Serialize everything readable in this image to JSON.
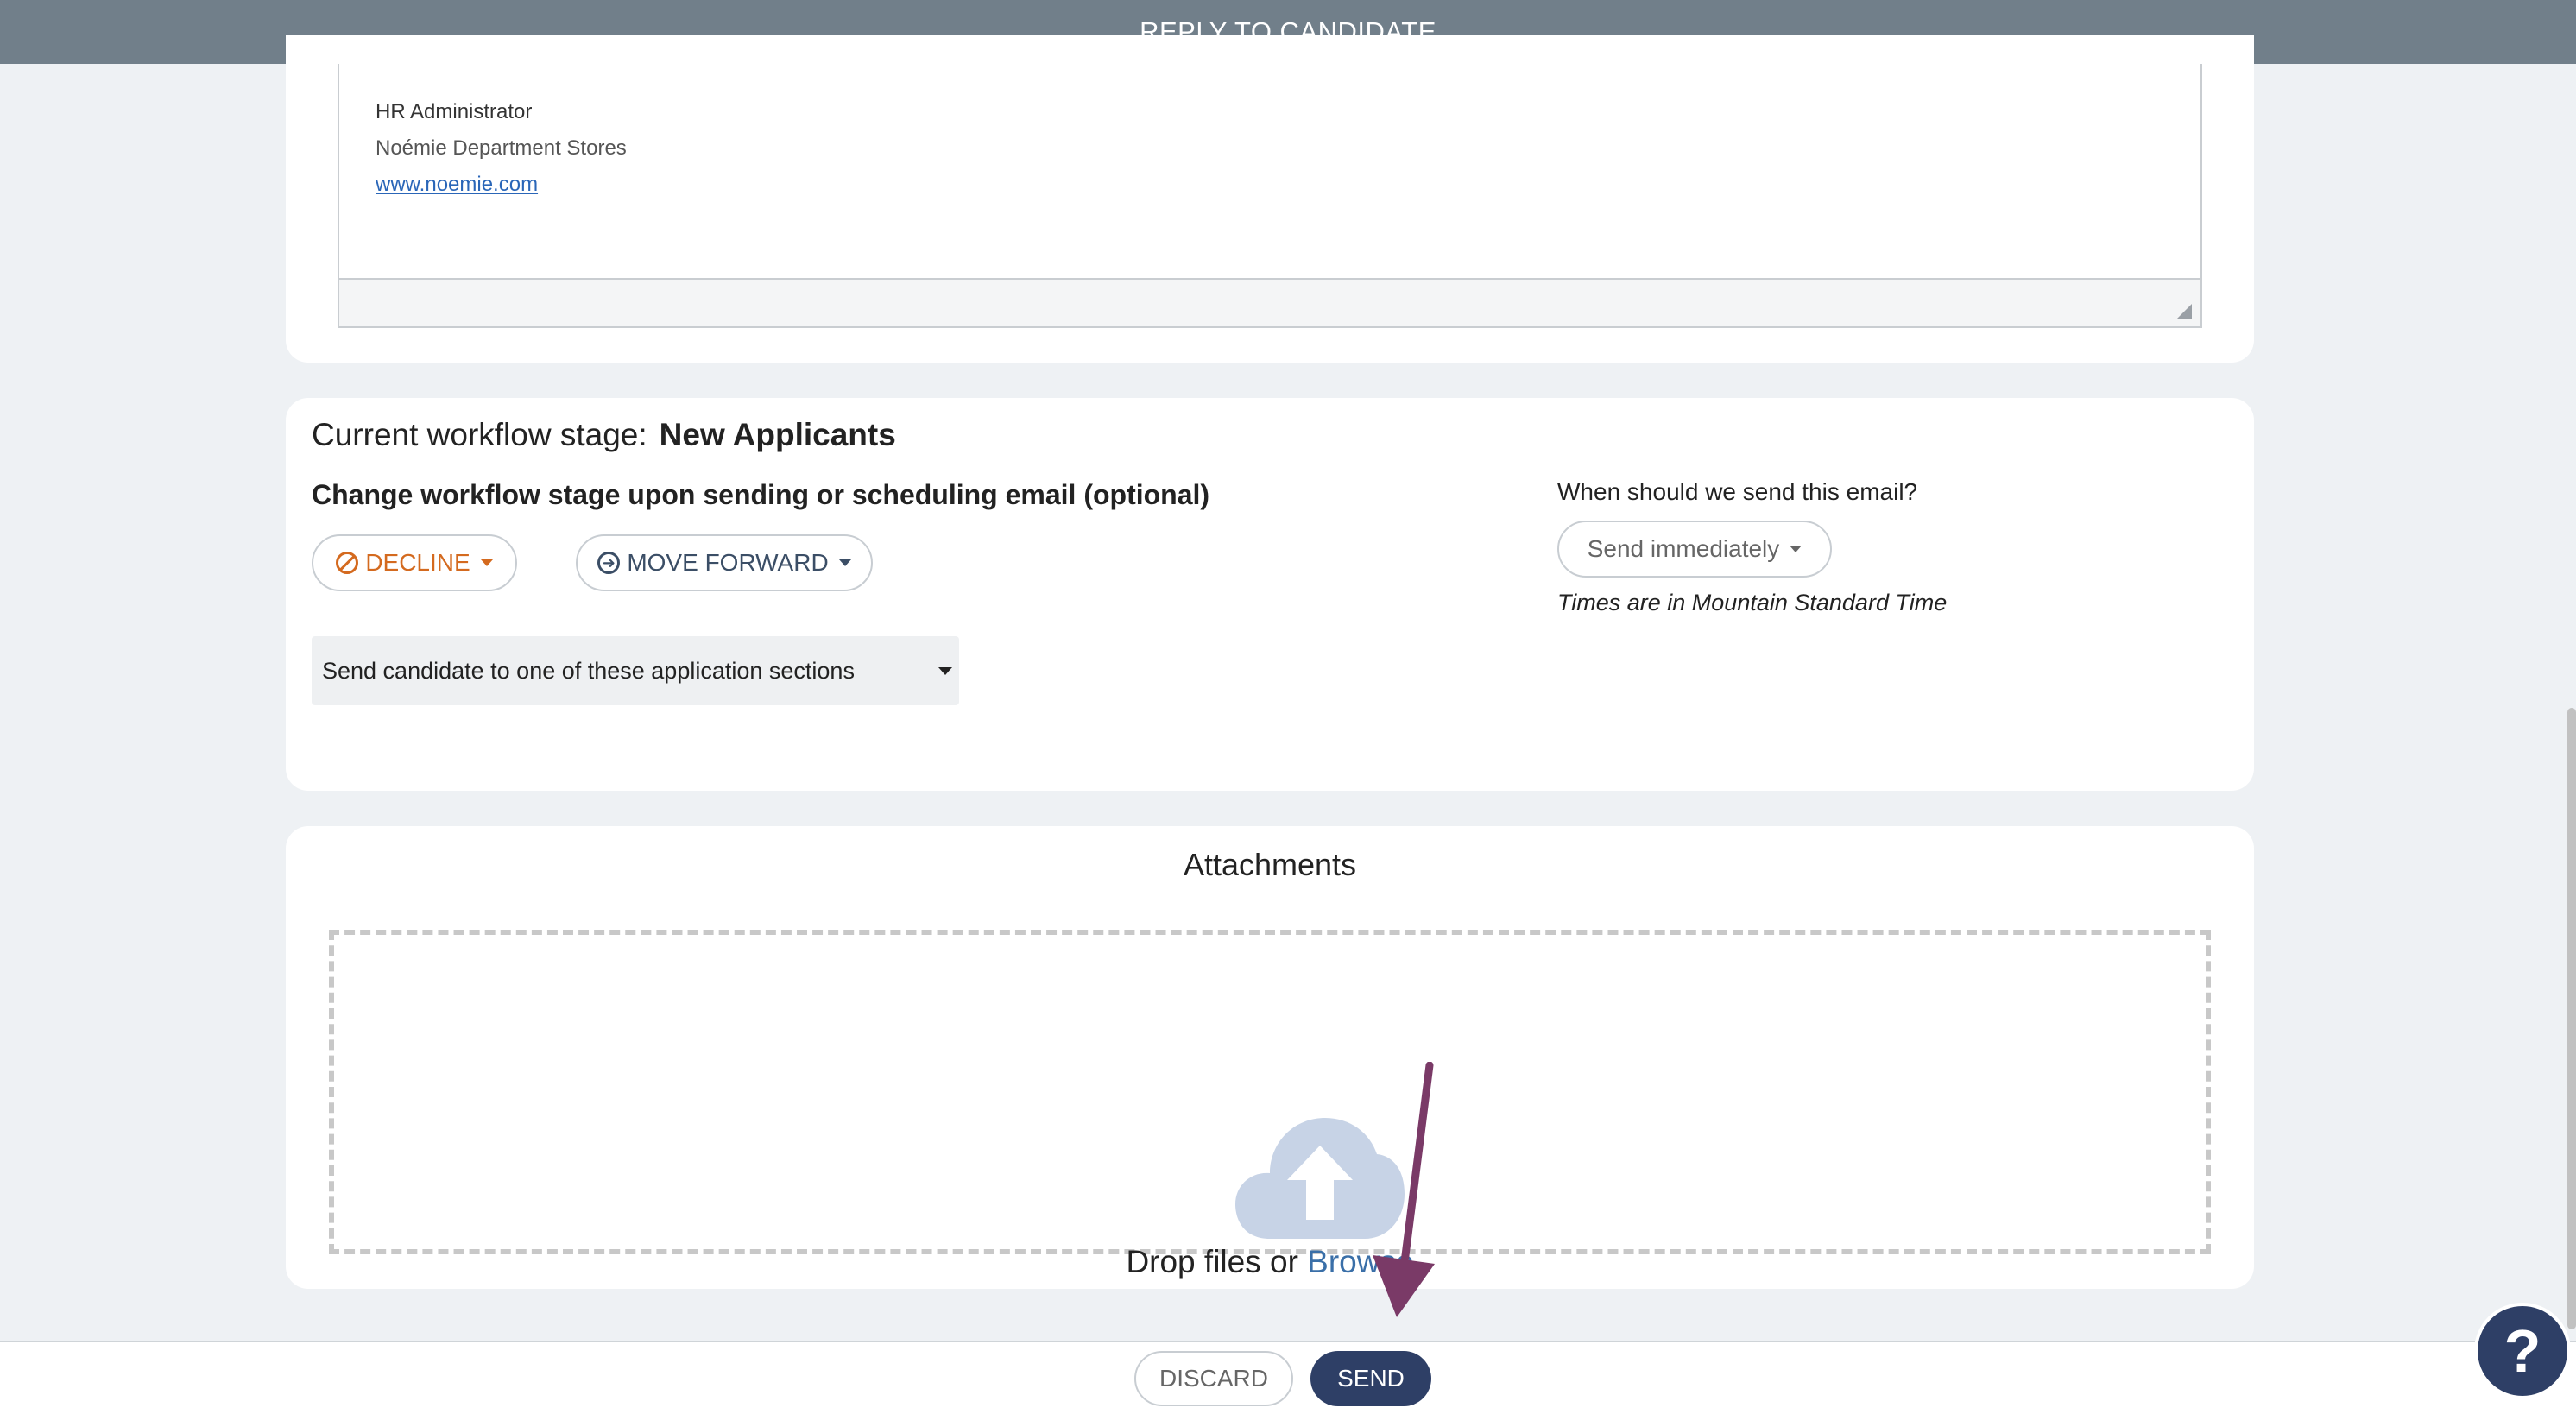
{
  "header": {
    "title": "REPLY TO CANDIDATE"
  },
  "signature": {
    "role": "HR Administrator",
    "company": "Noémie Department Stores",
    "website": "www.noemie.com "
  },
  "workflow": {
    "current_label": "Current workflow stage:",
    "current_stage": "New Applicants",
    "change_label": "Change workflow stage upon sending or scheduling email (optional)",
    "decline_label": "DECLINE",
    "move_forward_label": "MOVE FORWARD",
    "section_select_value": "Send candidate to one of these application sections",
    "when_label": "When should we send this email?",
    "schedule_value": "Send immediately",
    "timezone_note": "Times are in Mountain Standard Time"
  },
  "attachments": {
    "title": "Attachments",
    "drop_text": "Drop files or ",
    "browse_label": "Browse"
  },
  "footer": {
    "discard_label": "DISCARD",
    "send_label": "SEND"
  },
  "help": {
    "label": "?"
  },
  "colors": {
    "header_bg": "#717f8a",
    "decline": "#d46a1f",
    "primary": "#2e3f66",
    "annotation_arrow": "#7a3a67",
    "link": "#2a66b8"
  }
}
